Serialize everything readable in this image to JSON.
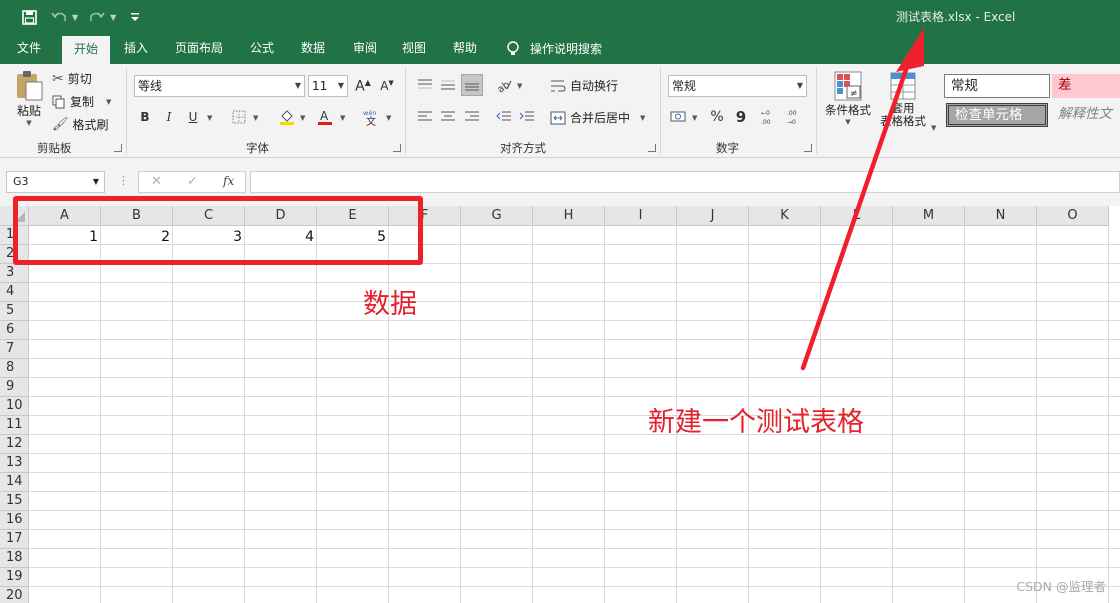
{
  "window": {
    "title": "测试表格.xlsx  -  Excel"
  },
  "tabs": [
    {
      "label": "文件"
    },
    {
      "label": "开始"
    },
    {
      "label": "插入"
    },
    {
      "label": "页面布局"
    },
    {
      "label": "公式"
    },
    {
      "label": "数据"
    },
    {
      "label": "审阅"
    },
    {
      "label": "视图"
    },
    {
      "label": "帮助"
    }
  ],
  "tell_me": "操作说明搜索",
  "ribbon": {
    "clipboard": {
      "paste": "粘贴",
      "cut": "剪切",
      "copy": "复制",
      "format_painter": "格式刷",
      "label": "剪贴板"
    },
    "font": {
      "name": "等线",
      "size": "11",
      "label": "字体",
      "bold": "B",
      "italic": "I",
      "underline": "U"
    },
    "alignment": {
      "wrap": "自动换行",
      "merge": "合并后居中",
      "label": "对齐方式"
    },
    "number": {
      "format": "常规",
      "label": "数字",
      "percent": "%",
      "comma": "9"
    },
    "styles": {
      "conditional": "条件格式",
      "table_format_line1": "套用",
      "table_format_line2": "表格格式",
      "normal": "常规",
      "bad": "差",
      "check_cell": "检查单元格",
      "explanatory": "解释性文"
    }
  },
  "formula_bar": {
    "name_box": "G3",
    "fx": "fx"
  },
  "grid": {
    "columns": [
      "A",
      "B",
      "C",
      "D",
      "E",
      "F",
      "G",
      "H",
      "I",
      "J",
      "K",
      "L",
      "M",
      "N",
      "O"
    ],
    "rows": [
      "1",
      "2",
      "3",
      "4",
      "5",
      "6",
      "7",
      "8",
      "9",
      "10",
      "11",
      "12",
      "13",
      "14",
      "15",
      "16",
      "17",
      "18",
      "19",
      "20"
    ],
    "row1_values": [
      "1",
      "2",
      "3",
      "4",
      "5"
    ]
  },
  "annotations": {
    "data_label": "数据",
    "new_table_label": "新建一个测试表格",
    "color": "#e5222c"
  },
  "watermark": "CSDN @监理者",
  "colors": {
    "excel_green": "#217346",
    "ribbon_bg": "#f3f3f3",
    "annotation_red": "#f0202b"
  }
}
